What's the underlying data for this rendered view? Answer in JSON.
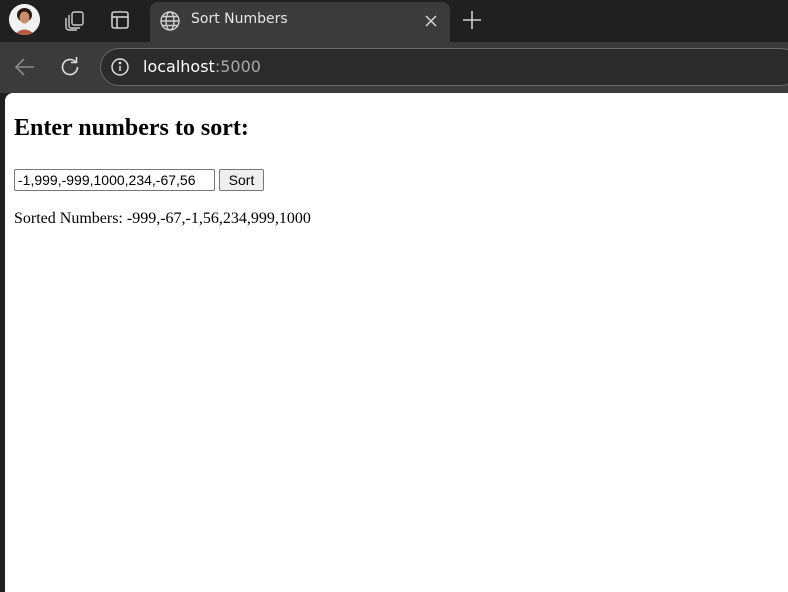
{
  "browser": {
    "tab": {
      "title": "Sort Numbers",
      "icon": "globe-icon"
    },
    "address_bar": {
      "host": "localhost",
      "port": ":5000"
    },
    "colors": {
      "chrome_dark": "#202020",
      "toolbar": "#3b3b3b",
      "omnibox": "#2b2b2b",
      "page_background": "#ffffff"
    }
  },
  "page": {
    "heading": "Enter numbers to sort:",
    "input": {
      "value": "-1,999,-999,1000,234,-67,56"
    },
    "sort_button_label": "Sort",
    "result": {
      "label": "Sorted Numbers:",
      "value": "-999,-67,-1,56,234,999,1000"
    }
  }
}
